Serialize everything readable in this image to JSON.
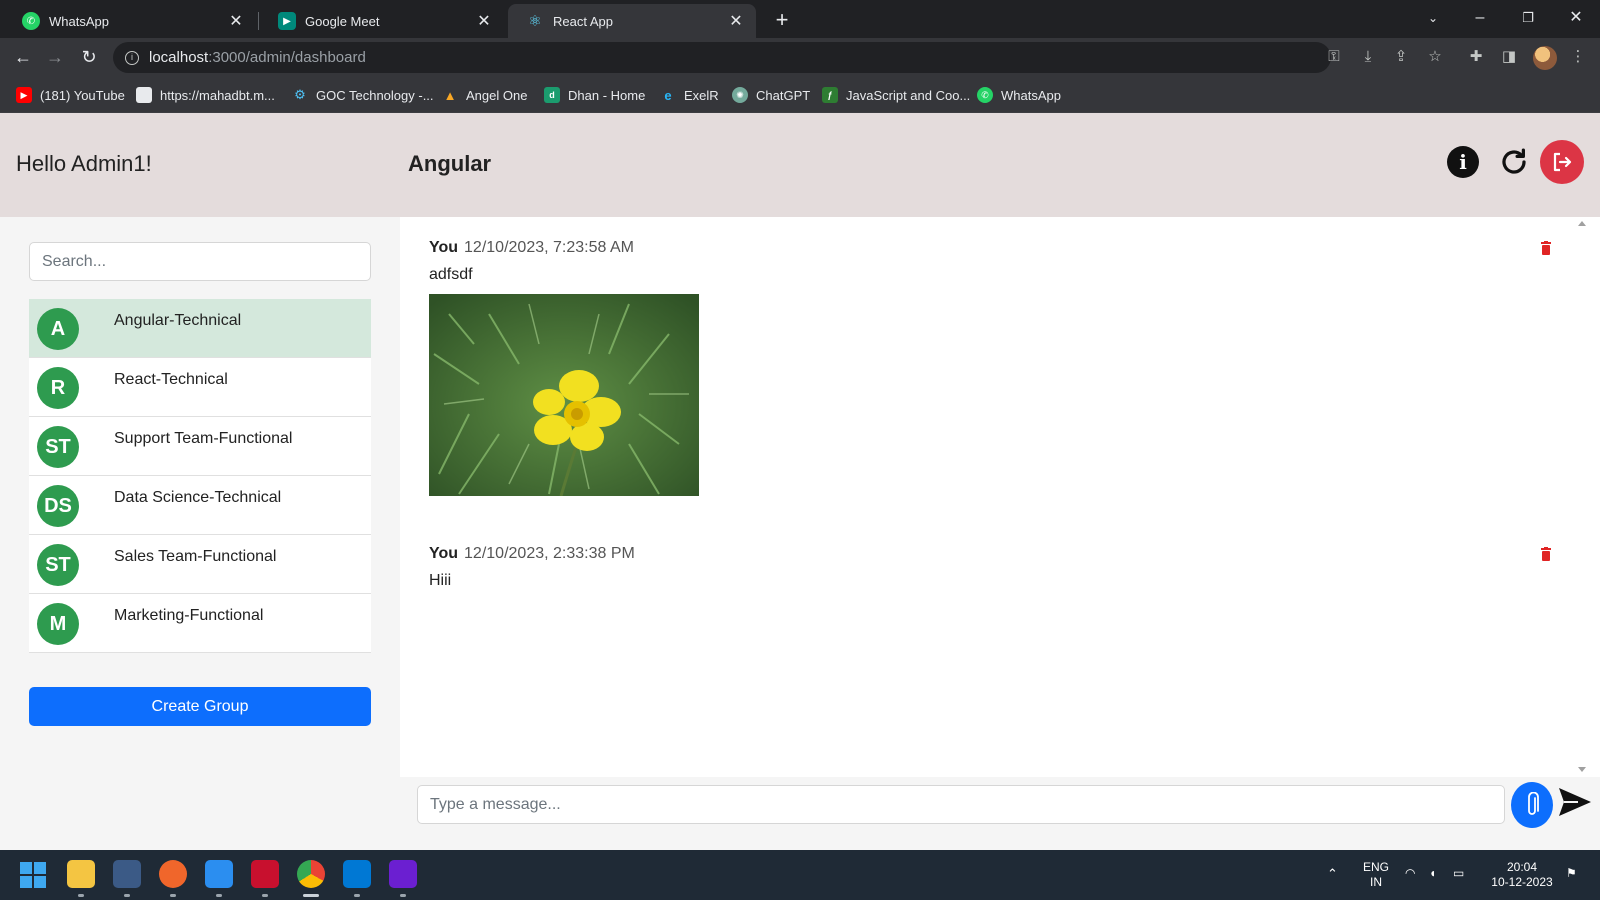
{
  "browser": {
    "tabs": [
      {
        "label": "WhatsApp",
        "icon": "whatsapp-icon",
        "active": false
      },
      {
        "label": "Google Meet",
        "icon": "google-meet-icon",
        "active": false
      },
      {
        "label": "React App",
        "icon": "react-icon",
        "active": true
      }
    ],
    "url_host": "localhost",
    "url_path": ":3000/admin/dashboard",
    "bookmarks": [
      {
        "label": "(181) YouTube",
        "icon": "youtube-icon"
      },
      {
        "label": "https://mahadbt.m...",
        "icon": "page-icon"
      },
      {
        "label": "GOC Technology -...",
        "icon": "goc-icon"
      },
      {
        "label": "Angel One",
        "icon": "angel-one-icon"
      },
      {
        "label": "Dhan - Home",
        "icon": "dhan-icon"
      },
      {
        "label": "ExelR",
        "icon": "exelr-icon"
      },
      {
        "label": "ChatGPT",
        "icon": "chatgpt-icon"
      },
      {
        "label": "JavaScript and Coo...",
        "icon": "javascript-icon"
      },
      {
        "label": "WhatsApp",
        "icon": "whatsapp-icon"
      }
    ]
  },
  "header": {
    "greeting": "Hello Admin1!",
    "group_title": "Angular"
  },
  "sidebar": {
    "search_placeholder": "Search...",
    "groups": [
      {
        "initials": "A",
        "name": "Angular-Technical",
        "active": true
      },
      {
        "initials": "R",
        "name": "React-Technical",
        "active": false
      },
      {
        "initials": "ST",
        "name": "Support Team-Functional",
        "active": false
      },
      {
        "initials": "DS",
        "name": "Data Science-Technical",
        "active": false
      },
      {
        "initials": "ST",
        "name": "Sales Team-Functional",
        "active": false
      },
      {
        "initials": "M",
        "name": "Marketing-Functional",
        "active": false
      }
    ],
    "create_group_label": "Create Group"
  },
  "messages": [
    {
      "sender": "You",
      "time": "12/10/2023, 7:23:58 AM",
      "text": "adfsdf",
      "has_image": true
    },
    {
      "sender": "You",
      "time": "12/10/2023, 2:33:38 PM",
      "text": "Hiii",
      "has_image": false
    }
  ],
  "composer": {
    "placeholder": "Type a message..."
  },
  "taskbar": {
    "language": "ENG",
    "region": "IN",
    "clock_time": "20:04",
    "clock_date": "10-12-2023"
  },
  "colors": {
    "header_bg": "#e4dcdc",
    "active_group": "#d4e8dc",
    "avatar": "#2e9b4f",
    "primary": "#0d6efd",
    "danger": "#dc3545"
  }
}
